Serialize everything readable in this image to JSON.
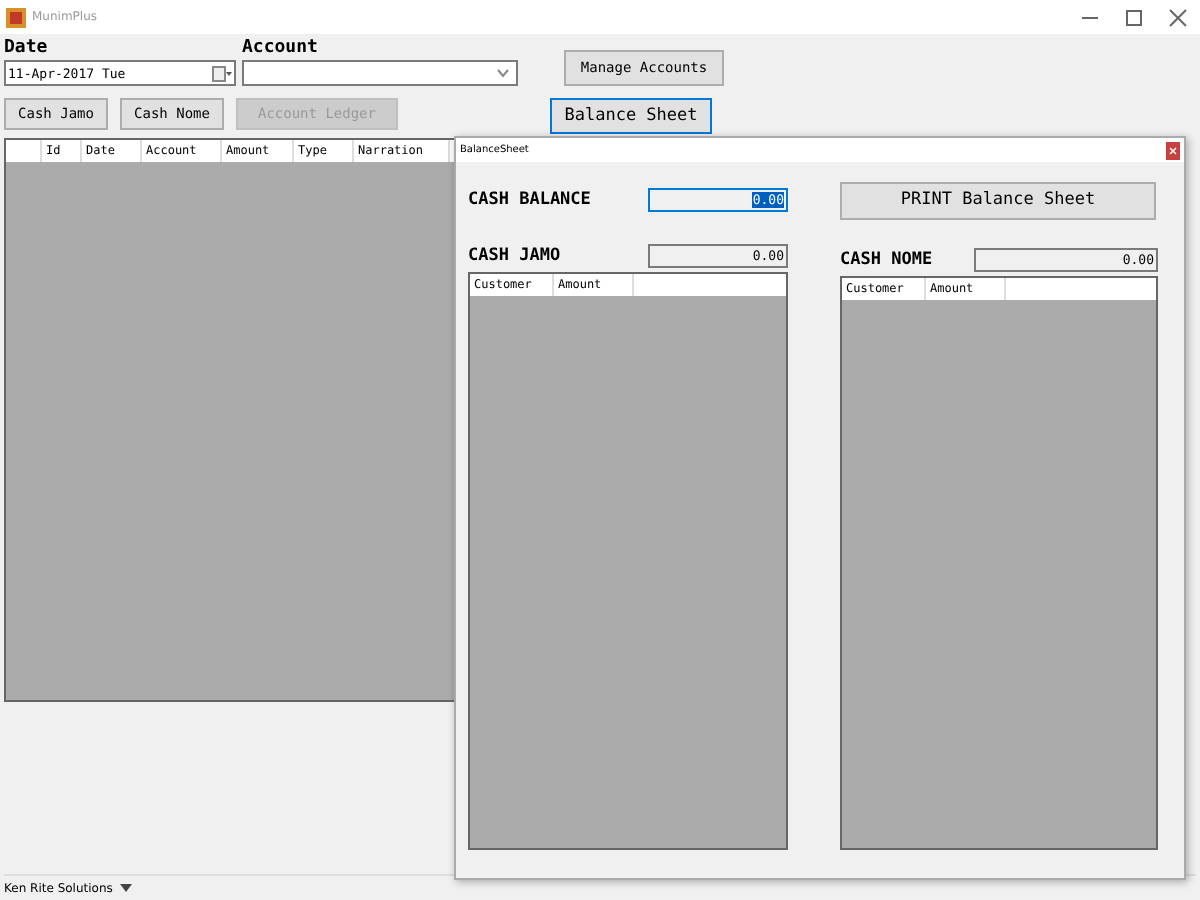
{
  "window": {
    "title": "MunimPlus"
  },
  "date": {
    "label": "Date",
    "value": "11-Apr-2017 Tue"
  },
  "account": {
    "label": "Account"
  },
  "buttons": [
    {
      "label": "Cash Jamo",
      "disabled": false
    },
    {
      "label": "Cash Nome",
      "disabled": false
    },
    {
      "label": "Account Ledger",
      "disabled": true
    }
  ],
  "manage_button": "Manage Accounts",
  "balance_button": "Balance Sheet",
  "table": {
    "columns": [
      "Id",
      "Date",
      "Account",
      "Amount",
      "Type",
      "Narration"
    ]
  },
  "balance_sheet": {
    "title": "BalanceSheet",
    "cash_balance": {
      "label": "CASH BALANCE",
      "value": "0.00"
    },
    "print_button": "PRINT Balance Sheet",
    "panels": [
      {
        "label": "CASH JAMO",
        "value": "0.00",
        "columns": [
          "Customer",
          "Amount"
        ]
      },
      {
        "label": "CASH NOME",
        "value": "0.00",
        "columns": [
          "Customer",
          "Amount"
        ]
      }
    ]
  },
  "status_bar": {
    "label": "Ken Rite Solutions"
  }
}
